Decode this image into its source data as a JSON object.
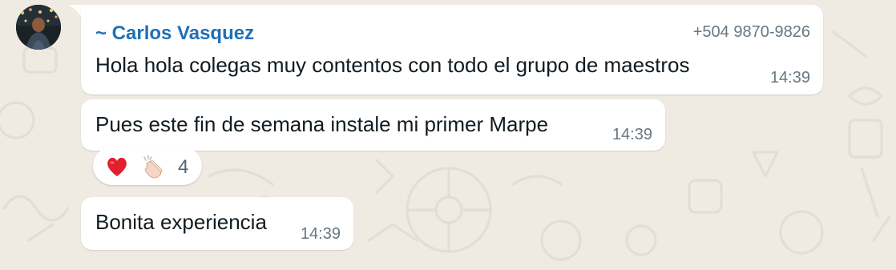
{
  "chat": {
    "sender": {
      "name": "~ Carlos Vasquez",
      "phone": "+504 9870-9826",
      "name_color": "#1f6fb8"
    },
    "messages": [
      {
        "text": "Hola hola colegas muy contentos con todo el grupo de maestros",
        "time": "14:39"
      },
      {
        "text": "Pues este fin de semana instale mi primer Marpe",
        "time": "14:39"
      },
      {
        "text": "Bonita experiencia",
        "time": "14:39"
      }
    ],
    "reactions": {
      "icons": [
        "red-heart-icon",
        "clapping-hands-icon"
      ],
      "count": "4"
    }
  },
  "colors": {
    "background": "#efeae2",
    "bubble": "#ffffff",
    "timestamp": "#667781"
  }
}
